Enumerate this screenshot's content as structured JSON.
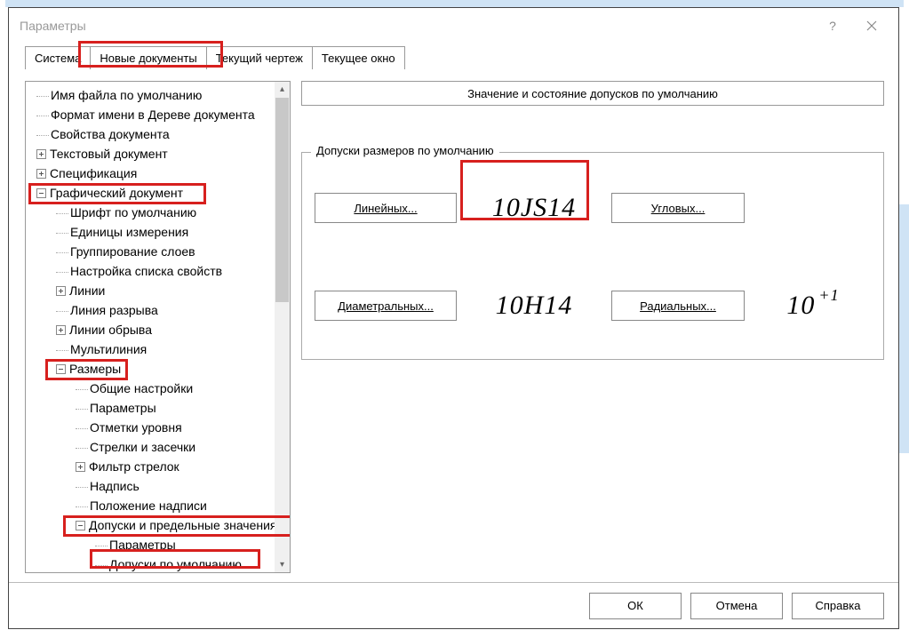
{
  "window": {
    "title": "Параметры"
  },
  "tabs": {
    "system": "Система",
    "new_docs": "Новые документы",
    "current_drawing": "Текущий чертеж",
    "current_window": "Текущее окно"
  },
  "tree": {
    "n0": "Имя файла по умолчанию",
    "n1": "Формат имени в Дереве документа",
    "n2": "Свойства документа",
    "n3": "Текстовый документ",
    "n4": "Спецификация",
    "n5": "Графический документ",
    "n5a": "Шрифт по умолчанию",
    "n5b": "Единицы измерения",
    "n5c": "Группирование слоев",
    "n5d": "Настройка списка свойств",
    "n5e": "Линии",
    "n5f": "Линия разрыва",
    "n5g": "Линии обрыва",
    "n5h": "Мультилиния",
    "n5i": "Размеры",
    "n5i1": "Общие настройки",
    "n5i2": "Параметры",
    "n5i3": "Отметки уровня",
    "n5i4": "Стрелки и засечки",
    "n5i5": "Фильтр стрелок",
    "n5i6": "Надпись",
    "n5i7": "Положение надписи",
    "n5i8": "Допуски и предельные значения",
    "n5i8a": "Параметры",
    "n5i8b": "Допуски по умолчанию"
  },
  "panel": {
    "header": "Значение и состояние допусков по умолчанию",
    "group_title": "Допуски размеров по умолчанию",
    "btn_linear": "Линейных...",
    "btn_angular": "Угловых...",
    "btn_diam": "Диаметральных...",
    "btn_radial": "Радиальных...",
    "prev_linear": "10JS14",
    "prev_angular": "",
    "prev_diam": "10H14",
    "prev_radial_main": "10",
    "prev_radial_sup": "+1"
  },
  "footer": {
    "ok": "ОК",
    "cancel": "Отмена",
    "help": "Справка"
  }
}
